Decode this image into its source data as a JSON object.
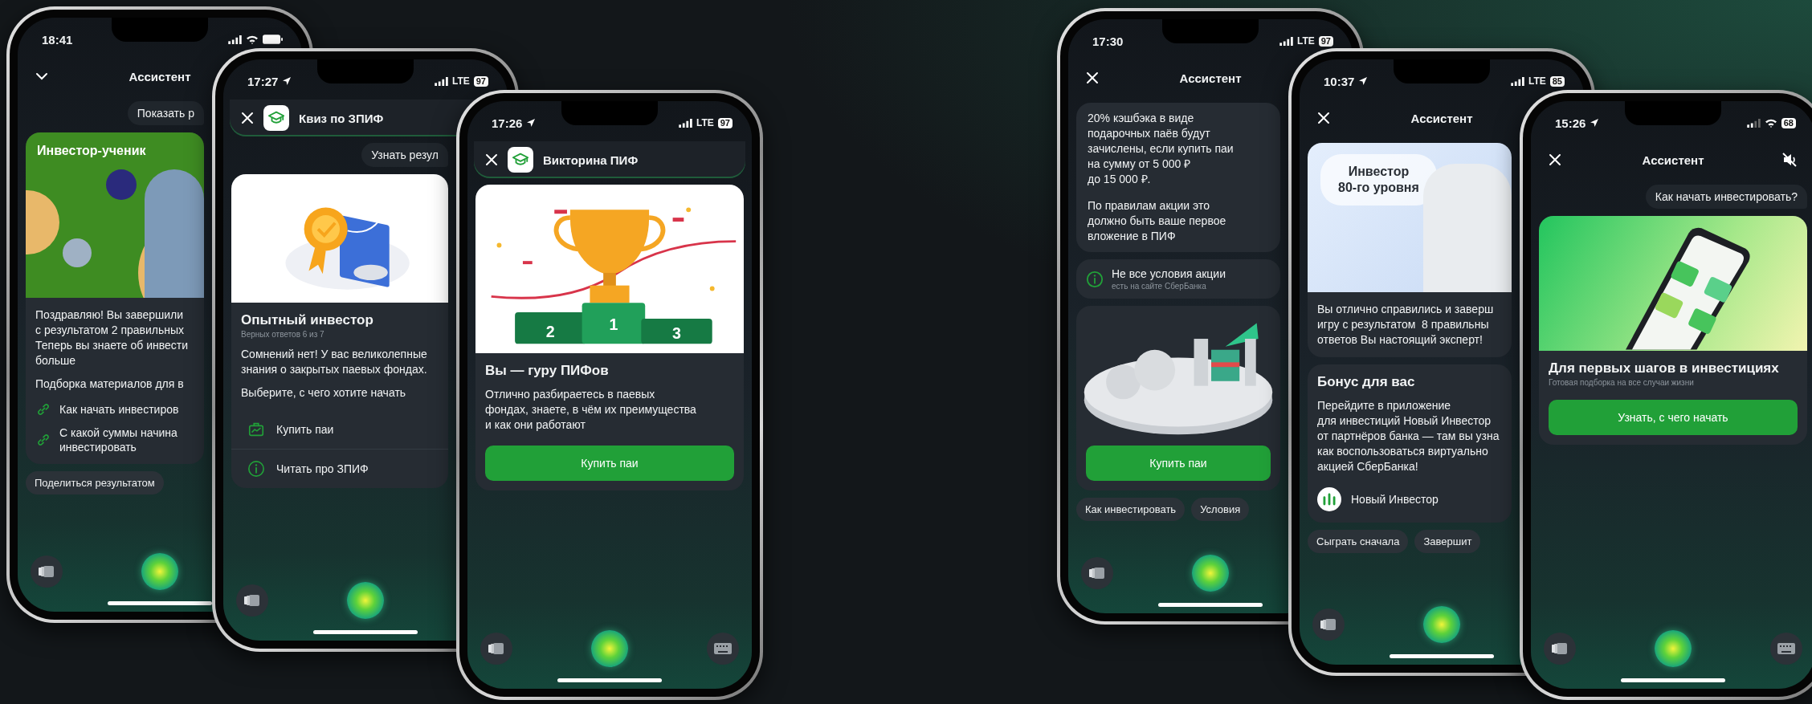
{
  "phones": [
    {
      "status": {
        "time": "18:41",
        "location": false,
        "wifi": true
      },
      "header": {
        "kind": "centered",
        "nav": {
          "kind": "chevron"
        },
        "title": "Ассистент",
        "mute": false
      },
      "blocks": [
        {
          "kind": "bubble",
          "text": "Показать р"
        },
        {
          "kind": "card",
          "image": {
            "kind": "person-green",
            "title_lines": [
              "Инвестор-ученик"
            ]
          },
          "paragraphs": [
            [
              "Поздравляю! Вы завершили",
              "с результатом 2 правильных",
              "Теперь вы знаете об инвести",
              "больше"
            ],
            [
              "Подборка материалов для в"
            ]
          ],
          "links": [
            {
              "lines": [
                "Как начать инвестиров"
              ]
            },
            {
              "lines": [
                "С какой суммы начина",
                "инвестировать"
              ]
            }
          ]
        },
        {
          "kind": "chips",
          "items": [
            "Поделиться результатом"
          ]
        }
      ],
      "bottom": {
        "keyboard": false
      }
    },
    {
      "status": {
        "time": "17:27",
        "location": true,
        "network": "LTE",
        "wifi": false,
        "battery": "97"
      },
      "header": {
        "kind": "app",
        "nav": {
          "kind": "close"
        },
        "title": "Квиз по ЗПИФ",
        "mute": false
      },
      "blocks": [
        {
          "kind": "bubble",
          "text": "Узнать резул"
        },
        {
          "kind": "card",
          "image": {
            "kind": "badge"
          },
          "title": "Опытный инвестор",
          "subtitle": "Верных ответов 6 из 7",
          "paragraphs": [
            [
              "Сомнений нет! У вас великолепные",
              "знания о закрытых паевых фондах."
            ],
            [
              "Выберите, с чего хотите начать"
            ]
          ],
          "actions": [
            {
              "kind": "briefcase",
              "label": "Купить паи"
            },
            {
              "kind": "info",
              "label": "Читать про ЗПИФ"
            }
          ]
        }
      ],
      "bottom": {
        "keyboard": false
      }
    },
    {
      "status": {
        "time": "17:26",
        "location": true,
        "network": "LTE",
        "wifi": false,
        "battery": "97"
      },
      "header": {
        "kind": "app",
        "nav": {
          "kind": "close"
        },
        "title": "Викторина ПИФ",
        "mute": false
      },
      "blocks": [
        {
          "kind": "card",
          "image": {
            "kind": "trophy",
            "labels": [
              "2",
              "1",
              "3"
            ]
          },
          "title": "Вы — гуру ПИФов",
          "paragraphs": [
            [
              "Отлично разбираетесь в паевых",
              "фондах, знаете, в чём их преимущества",
              "и как они работают"
            ]
          ],
          "button": "Купить паи"
        }
      ],
      "bottom": {
        "keyboard": true
      }
    },
    {
      "status": {
        "time": "17:30",
        "location": false,
        "network": "LTE",
        "wifi": false,
        "battery": "97"
      },
      "header": {
        "kind": "centered",
        "nav": {
          "kind": "close"
        },
        "title": "Ассистент",
        "mute": false
      },
      "blocks": [
        {
          "kind": "text_card",
          "paragraphs": [
            [
              "20% кэшбэка в виде",
              "подарочных паёв будут",
              "зачислены, если купить паи",
              "на сумму от 5 000 ₽",
              "до 15 000 ₽."
            ],
            [
              "По правилам акции это",
              "должно быть ваше первое",
              "вложение в ПИФ"
            ]
          ]
        },
        {
          "kind": "info",
          "title": "Не все условия акции",
          "subtitle": "есть на сайте СберБанка"
        },
        {
          "kind": "card",
          "image": {
            "kind": "promo-3d"
          },
          "button": "Купить паи"
        },
        {
          "kind": "chips",
          "items": [
            "Как инвестировать",
            "Условия"
          ]
        }
      ],
      "bottom": {
        "keyboard": false
      }
    },
    {
      "status": {
        "time": "10:37",
        "location": true,
        "network": "LTE",
        "wifi": false,
        "battery": "85"
      },
      "header": {
        "kind": "centered",
        "nav": {
          "kind": "close"
        },
        "title": "Ассистент",
        "mute": false
      },
      "blocks": [
        {
          "kind": "card",
          "image": {
            "kind": "person-blue",
            "title_lines": [
              "Инвестор",
              "80-го уровня"
            ]
          },
          "paragraphs": [
            [
              "Вы отлично справились и заверш",
              "игру с результатом  8 правильны",
              "ответов Вы настоящий эксперт!"
            ]
          ]
        },
        {
          "kind": "card",
          "title": "Бонус для вас",
          "paragraphs": [
            [
              "Перейдите в приложение",
              "для инвестиций Новый Инвестор",
              "от партнёров банка — там вы узна",
              "как воспользоваться виртуально",
              "акцией СберБанка!"
            ]
          ],
          "app": "Новый Инвестор"
        },
        {
          "kind": "chips",
          "items": [
            "Сыграть сначала",
            "Завершит"
          ]
        }
      ],
      "bottom": {
        "keyboard": false
      }
    },
    {
      "status": {
        "time": "15:26",
        "location": true,
        "wifi": true,
        "battery": "68"
      },
      "header": {
        "kind": "centered",
        "nav": {
          "kind": "close"
        },
        "title": "Ассистент",
        "mute": true
      },
      "blocks": [
        {
          "kind": "bubble",
          "text": "Как начать инвестировать?"
        },
        {
          "kind": "card",
          "image": {
            "kind": "phone-gradient"
          },
          "title": "Для первых шагов в инвестициях",
          "subtitle": "Готовая подборка на все случаи жизни",
          "button": "Узнать, с чего начать"
        }
      ],
      "bottom": {
        "keyboard": true
      }
    }
  ]
}
